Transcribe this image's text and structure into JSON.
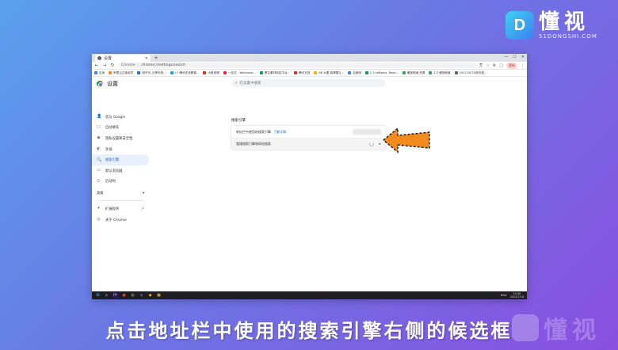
{
  "brand": {
    "logo_letter": "D",
    "name_cn": "懂视",
    "name_en": "51DONGSHI.COM"
  },
  "browser": {
    "tab_title": "设置",
    "tab_close": "✕",
    "new_tab": "+",
    "window_controls": [
      "—",
      "☐",
      "✕"
    ],
    "nav": {
      "back": "←",
      "forward": "→",
      "reload": "↻"
    },
    "omnibox_label": "Chrome",
    "omnibox_sep": "|",
    "url": "chrome://settings/search",
    "right_icons": [
      "⎘",
      "☆",
      "⚙",
      "▢",
      "⋮"
    ],
    "profile_label": "更新",
    "bookmarks": [
      {
        "label": "应用",
        "color": "#4285f4"
      },
      {
        "label": "阿里云正版软件",
        "color": "#f28b2d"
      },
      {
        "label": "知乎问_分享你的...",
        "color": "#1a73e8"
      },
      {
        "label": "17 腾讯在线教育...",
        "color": "#1aa5e8"
      },
      {
        "label": "大象视频",
        "color": "#d93025"
      },
      {
        "label": "一站式 - Yoltaneke...",
        "color": "#d93025"
      },
      {
        "label": "着实素材网站平台...",
        "color": "#0f9d58"
      },
      {
        "label": "腾讯文档",
        "color": "#d93025"
      },
      {
        "label": "8K 大图 超清图片...",
        "color": "#f4b400"
      },
      {
        "label": "百度网",
        "color": "#4285f4"
      },
      {
        "label": "2.5 softbms: Rese...",
        "color": "#0f9d58"
      },
      {
        "label": "懂视频道 资源",
        "color": "#34a853"
      },
      {
        "label": "2.5 懂视频道",
        "color": "#34a853"
      },
      {
        "label": "2022-08 TA资讯部...",
        "color": "#5f6368"
      }
    ]
  },
  "settings": {
    "title": "设置",
    "search_placeholder": "在设置中搜索",
    "sidebar": [
      {
        "icon": "👤",
        "icon_name": "person-icon",
        "label": "您与 Google",
        "active": false
      },
      {
        "icon": "☐",
        "icon_name": "autofill-icon",
        "label": "自动填充",
        "active": false
      },
      {
        "icon": "◉",
        "icon_name": "shield-icon",
        "label": "隐私设置和安全性",
        "active": false
      },
      {
        "icon": "◐",
        "icon_name": "palette-icon",
        "label": "外观",
        "active": false
      },
      {
        "icon": "🔍",
        "icon_name": "search-icon",
        "label": "搜索引擎",
        "active": true
      },
      {
        "icon": "▭",
        "icon_name": "browser-icon",
        "label": "默认浏览器",
        "active": false
      },
      {
        "icon": "⏻",
        "icon_name": "power-icon",
        "label": "启动时",
        "active": false
      }
    ],
    "advanced_label": "高级",
    "advanced_caret": "▾",
    "bottom_items": [
      {
        "icon": "✦",
        "icon_name": "puzzle-icon",
        "label": "扩展程序",
        "external": "↗"
      },
      {
        "icon": "◎",
        "icon_name": "chrome-icon",
        "label": "关于 Chrome",
        "external": ""
      }
    ],
    "section_title": "搜索引擎",
    "row1_text": "地址栏中使用的搜索引擎",
    "row1_link": "了解详情",
    "row2_text": "管理搜索引擎和网站搜索",
    "row2_caret": "▸"
  },
  "taskbar": {
    "start": "⊞",
    "apps": [
      "⌕",
      "Pr",
      "●",
      "◍",
      "e",
      "◆",
      "▣"
    ],
    "tray": "ENG",
    "time": "10:40",
    "date": "2022/7/18"
  },
  "subtitle": "点击地址栏中使用的搜索引擎右侧的候选框",
  "watermark_text": "懂视"
}
